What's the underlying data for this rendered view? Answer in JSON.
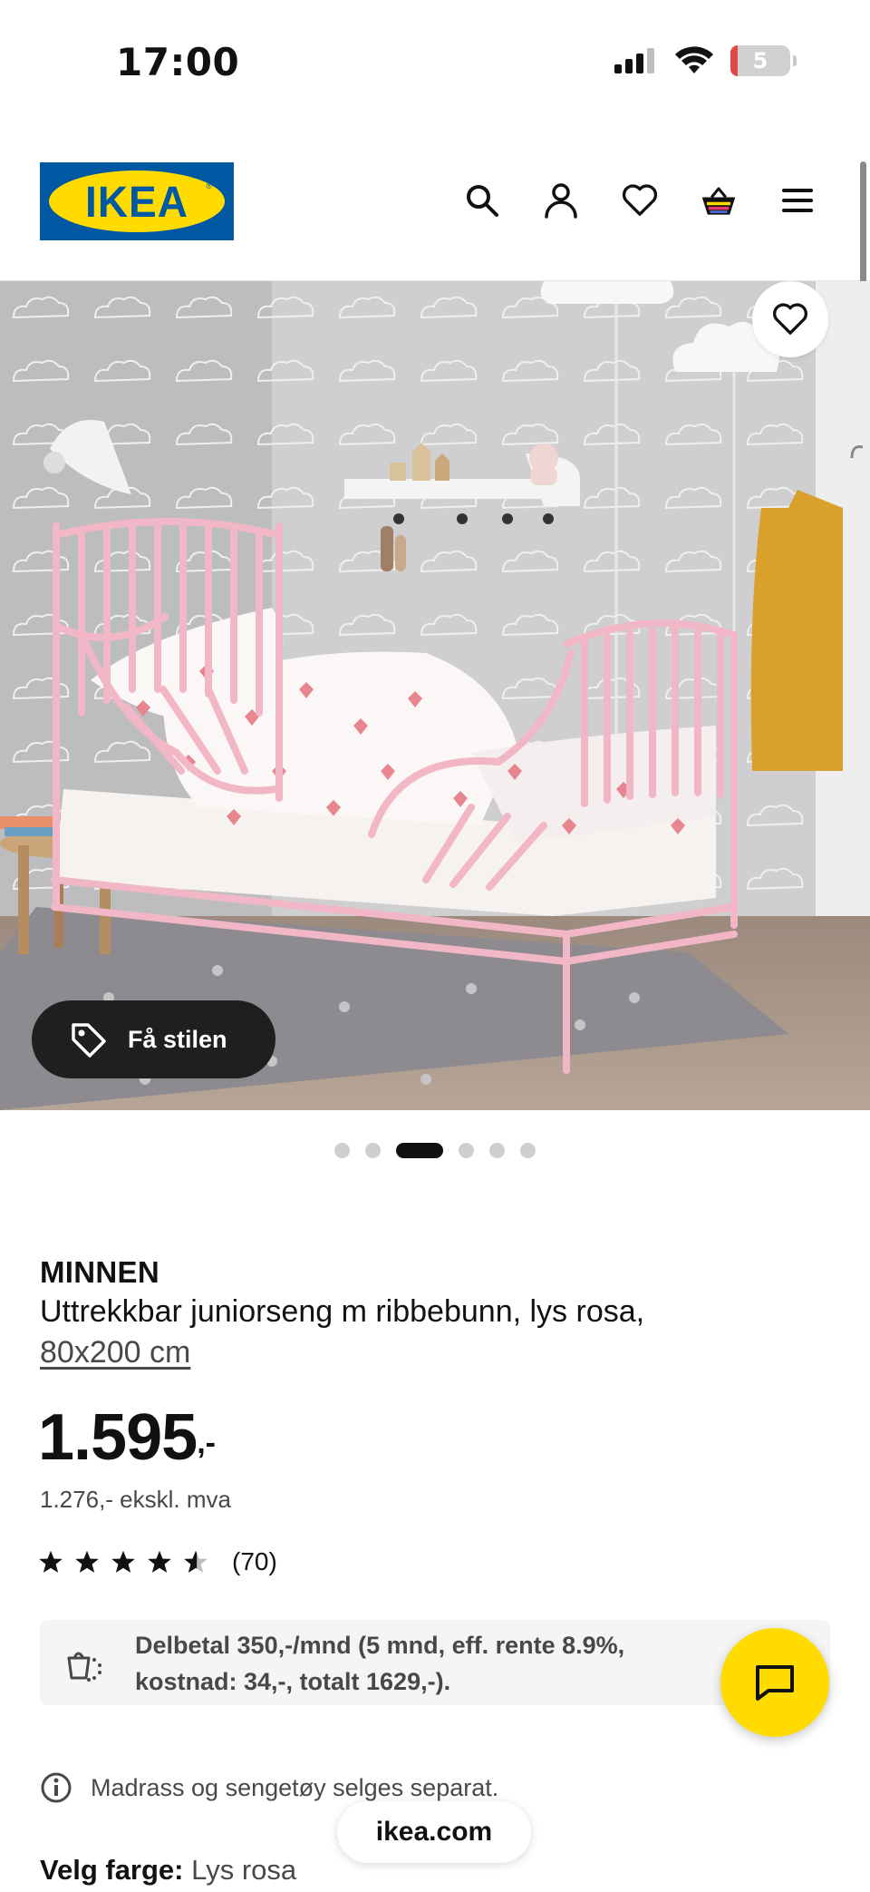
{
  "status_bar": {
    "time": "17:00",
    "battery_level": "5"
  },
  "header": {
    "logo_text": "IKEA",
    "icons": [
      "search-icon",
      "profile-icon",
      "heart-icon",
      "basket-icon",
      "menu-icon"
    ]
  },
  "hero": {
    "style_button_label": "Få stilen",
    "dots_total": 6,
    "dots_active": 3
  },
  "product": {
    "name": "MINNEN",
    "description": "Uttrekkbar juniorseng m ribbebunn, lys rosa,",
    "size_link": "80x200 cm",
    "price": "1.595",
    "price_suffix": ",-",
    "price_ex_vat": "1.276,- ekskl. mva",
    "rating_value": 4.5,
    "rating_max": 5,
    "rating_count": "(70)"
  },
  "installment": {
    "text": "Delbetal 350,-/mnd (5 mnd, eff. rente 8.9%, kostnad: 34,-, totalt 1629,-)."
  },
  "notice": {
    "text": "Madrass og sengetøy selges separat."
  },
  "browser": {
    "url": "ikea.com"
  },
  "color_select": {
    "label": "Velg farge:",
    "value": "Lys rosa"
  },
  "colors": {
    "ikea_blue": "#0058a3",
    "ikea_yellow": "#ffdb00",
    "bed_pink": "#f2b7c6"
  }
}
